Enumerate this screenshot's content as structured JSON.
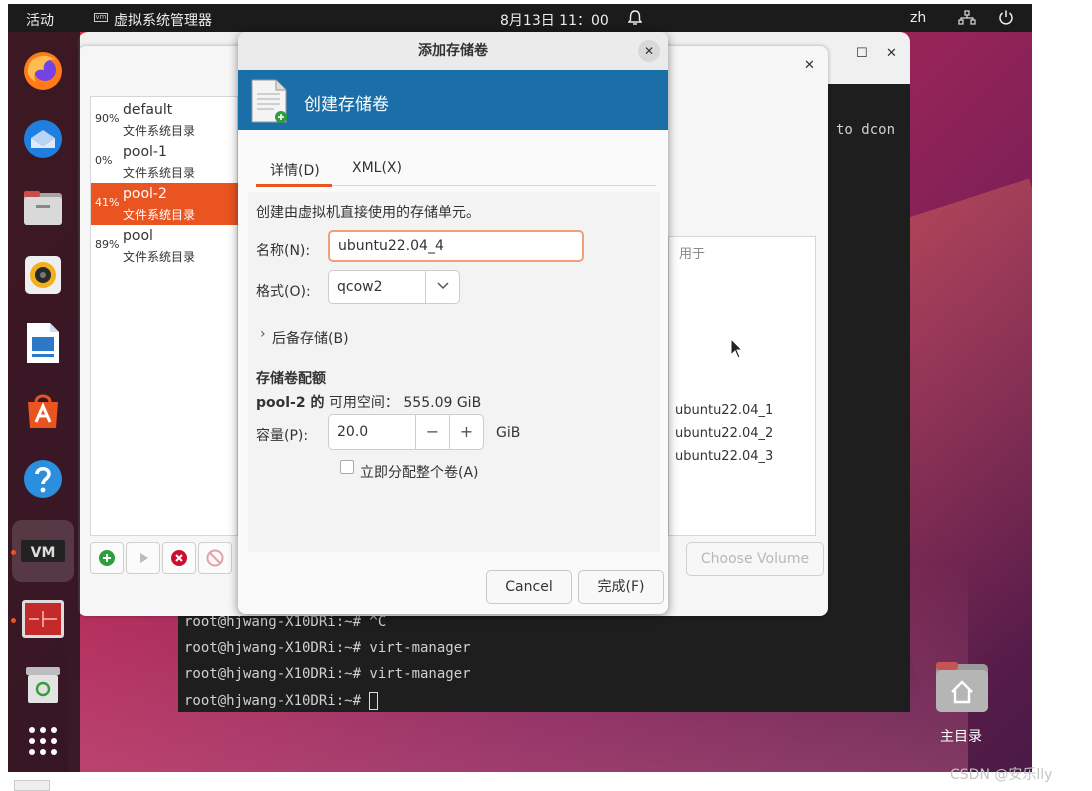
{
  "topbar": {
    "activities": "活动",
    "app_name": "虚拟系统管理器",
    "clock": "8月13日  11：00",
    "lang": "zh"
  },
  "terminal": {
    "partial_right": "to dcon",
    "lines": [
      "root@hjwang-X10DRi:~# ^C",
      "root@hjwang-X10DRi:~# virt-manager",
      "root@hjwang-X10DRi:~# virt-manager",
      "root@hjwang-X10DRi:~# "
    ]
  },
  "pools": [
    {
      "pct": "90%",
      "name": "default",
      "type": "文件系统目录"
    },
    {
      "pct": "0%",
      "name": "pool-1",
      "type": "文件系统目录"
    },
    {
      "pct": "41%",
      "name": "pool-2",
      "type": "文件系统目录"
    },
    {
      "pct": "89%",
      "name": "pool",
      "type": "文件系统目录"
    }
  ],
  "volumes": {
    "header": "用于",
    "items": [
      "ubuntu22.04_1",
      "ubuntu22.04_2",
      "ubuntu22.04_3"
    ]
  },
  "pool_window": {
    "choose_volume": "Choose Volume"
  },
  "dialog": {
    "title": "添加存储卷",
    "banner": "创建存储卷",
    "tabs": [
      "详情(D)",
      "XML(X)"
    ],
    "description": "创建由虚拟机直接使用的存储单元。",
    "name_label": "名称(N):",
    "name_value": "ubuntu22.04_4",
    "format_label": "格式(O):",
    "format_value": "qcow2",
    "backing": "后备存储(B)",
    "quota_heading": "存储卷配额",
    "pool_name": "pool-2 的",
    "avail_label": "可用空间：",
    "avail_value": "555.09 GiB",
    "capacity_label": "容量(P):",
    "capacity_value": "20.0",
    "capacity_unit": "GiB",
    "alloc_label": "立即分配整个卷(A)",
    "cancel": "Cancel",
    "finish": "完成(F)"
  },
  "desktop": {
    "home_label": "主目录"
  },
  "watermark": "CSDN @安乐lly",
  "colors": {
    "accent": "#e95420",
    "banner": "#1b6fa8",
    "topbar": "#1b1b1b"
  }
}
